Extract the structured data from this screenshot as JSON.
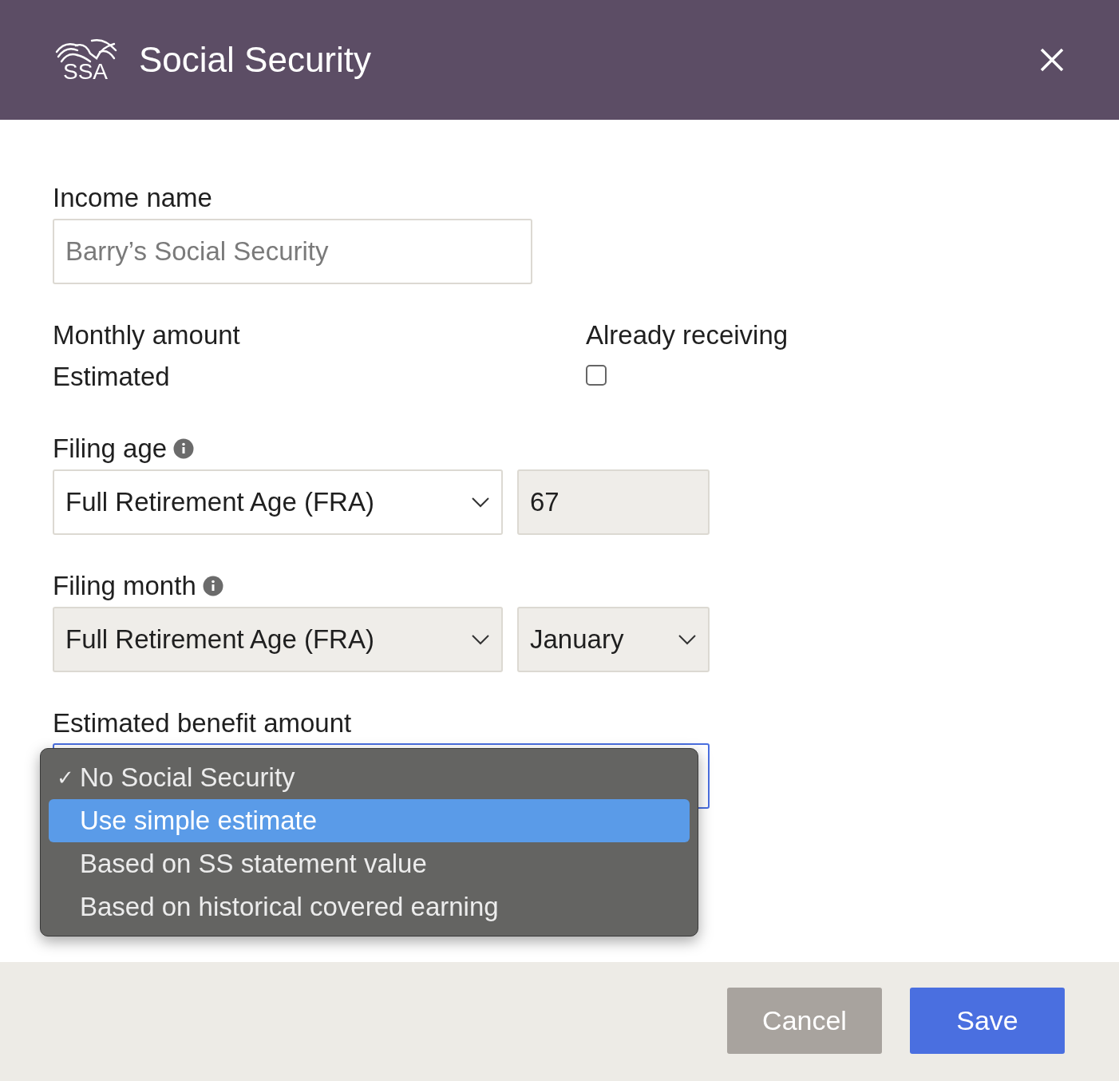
{
  "header": {
    "logo_text": "SSA",
    "title": "Social Security"
  },
  "income_name": {
    "label": "Income name",
    "placeholder": "Barry’s Social Security"
  },
  "monthly_amount": {
    "label": "Monthly amount",
    "value": "Estimated"
  },
  "already_receiving": {
    "label": "Already receiving",
    "checked": false
  },
  "filing_age": {
    "label": "Filing age",
    "select": {
      "value": "Full Retirement Age (FRA)",
      "disabled": false
    },
    "age": {
      "value": "67",
      "disabled": true
    }
  },
  "filing_month": {
    "label": "Filing month",
    "select": {
      "value": "Full Retirement Age (FRA)",
      "disabled": true
    },
    "month": {
      "value": "January",
      "disabled": true
    }
  },
  "estimated_benefit": {
    "label": "Estimated benefit amount",
    "focused": true,
    "options": [
      {
        "label": "No Social Security",
        "checked": true,
        "selected": false
      },
      {
        "label": "Use simple estimate",
        "checked": false,
        "selected": true
      },
      {
        "label": "Based on SS statement value",
        "checked": false,
        "selected": false
      },
      {
        "label": "Based on historical covered earning",
        "checked": false,
        "selected": false
      }
    ]
  },
  "check_mark": "✓",
  "buttons": [
    {
      "label": "Cancel",
      "kind": "secondary"
    },
    {
      "label": "Save",
      "kind": "primary"
    }
  ]
}
